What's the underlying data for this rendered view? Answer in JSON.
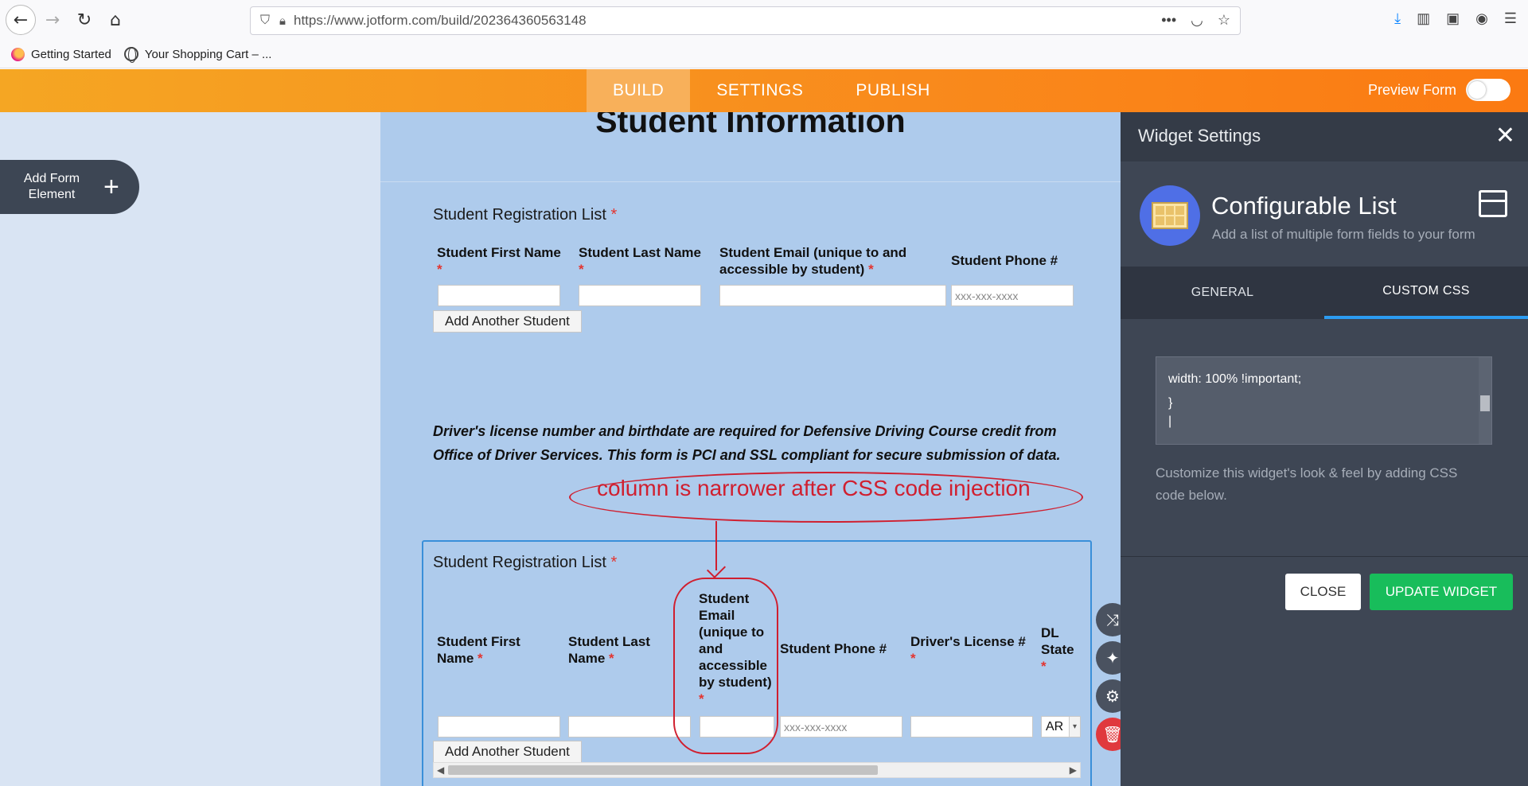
{
  "browser": {
    "url": "https://www.jotform.com/build/202364360563148",
    "bookmarks": [
      "Getting Started",
      "Your Shopping Cart – ..."
    ]
  },
  "header": {
    "tabs": [
      "BUILD",
      "SETTINGS",
      "PUBLISH"
    ],
    "active_tab": "BUILD",
    "preview_label": "Preview Form"
  },
  "left_panel": {
    "add_element_label": "Add Form Element"
  },
  "form": {
    "title": "Student Information",
    "list1": {
      "label": "Student Registration List",
      "columns": [
        "Student First Name",
        "Student Last Name",
        "Student Email (unique to and accessible by student)",
        "Student Phone #"
      ],
      "phone_placeholder": "xxx-xxx-xxxx",
      "add_button": "Add Another Student"
    },
    "notice": "Driver's license number and birthdate are required for Defensive Driving Course credit from Office of Driver Services. This form is PCI and SSL compliant for secure submission of data.",
    "list2": {
      "label": "Student Registration List",
      "columns": [
        "Student First Name",
        "Student Last Name",
        "Student Email (unique to and accessible by student)",
        "Student Phone #",
        "Driver's License #",
        "DL State"
      ],
      "phone_placeholder": "xxx-xxx-xxxx",
      "state_value": "AR",
      "add_button": "Add Another Student"
    },
    "required_mark": "*"
  },
  "annotation": {
    "text": "column is narrower after CSS code injection",
    "color": "#d01f2f"
  },
  "widget_settings": {
    "title": "Widget Settings",
    "widget_name": "Configurable List",
    "widget_desc": "Add a list of multiple form fields to your form",
    "tabs": [
      "GENERAL",
      "CUSTOM CSS"
    ],
    "active_tab": "CUSTOM CSS",
    "css_lines": [
      "width: 100% !important;",
      "}"
    ],
    "hint": "Customize this widget's look & feel by adding CSS code below.",
    "close_button": "CLOSE",
    "update_button": "UPDATE WIDGET"
  },
  "colors": {
    "header_orange": "#f98a1c",
    "panel_dark": "#3e4654",
    "canvas_blue": "#aecbec",
    "update_green": "#18bd5b",
    "accent_blue": "#2c9cf2"
  }
}
